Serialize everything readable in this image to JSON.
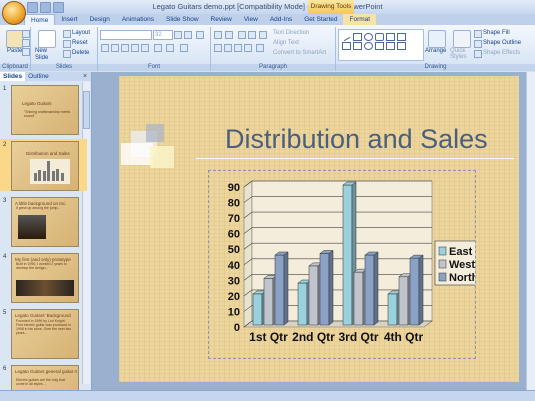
{
  "window": {
    "title": "Legato Guitars demo.ppt [Compatibility Mode] - Microsoft PowerPoint",
    "contextual_tab_group": "Drawing Tools"
  },
  "ribbon_tabs": [
    "Home",
    "Insert",
    "Design",
    "Animations",
    "Slide Show",
    "Review",
    "View",
    "Add-Ins",
    "Get Started",
    "Format"
  ],
  "ribbon": {
    "clipboard": {
      "label": "Clipboard",
      "paste": "Paste"
    },
    "slides": {
      "label": "Slides",
      "new_slide": "New Slide",
      "layout": "Layout",
      "reset": "Reset",
      "delete": "Delete"
    },
    "font": {
      "label": "Font",
      "size": "32"
    },
    "paragraph": {
      "label": "Paragraph",
      "text_direction": "Text Direction",
      "align_text": "Align Text",
      "convert_smartart": "Convert to SmartArt"
    },
    "drawing": {
      "label": "Drawing",
      "arrange": "Arrange",
      "quick_styles": "Quick Styles",
      "shape_fill": "Shape Fill",
      "shape_outline": "Shape Outline",
      "shape_effects": "Shape Effects"
    }
  },
  "pane": {
    "tabs": [
      "Slides",
      "Outline"
    ],
    "close": "×",
    "thumbnails": [
      {
        "num": "1",
        "title": "Legato Guitars",
        "sub": "\"Shining craftsmanship meets sound\""
      },
      {
        "num": "2",
        "title": "Distribution and Sales",
        "sub": ""
      },
      {
        "num": "3",
        "title": "A little background on Inc.",
        "sub": "It grew up among the jump..."
      },
      {
        "num": "4",
        "title": "My first (and only) prototype",
        "sub": "Built in 1990, I worked 2 years to develop the design..."
      },
      {
        "num": "5",
        "title": "Legato Guitars' Background",
        "sub": "Founded in 1996 by Lori Knight. First electric guitar was produced in 1998 in his store. Over the next two years..."
      },
      {
        "num": "6",
        "title": "Legato Guitars general guitar market info",
        "sub": "Electric guitars are the only that come in all styles..."
      }
    ]
  },
  "slide": {
    "title": "Distribution and Sales"
  },
  "chart_data": {
    "type": "bar",
    "categories": [
      "1st Qtr",
      "2nd Qtr",
      "3rd Qtr",
      "4th Qtr"
    ],
    "series": [
      {
        "name": "East",
        "color": "#9bd0dd",
        "values": [
          20,
          27,
          90,
          20
        ]
      },
      {
        "name": "West",
        "color": "#c0c4cc",
        "values": [
          30,
          38,
          34,
          31
        ]
      },
      {
        "name": "North",
        "color": "#8aa2c6",
        "values": [
          45,
          46,
          45,
          43
        ]
      }
    ],
    "yticks": [
      "0",
      "10",
      "20",
      "30",
      "40",
      "50",
      "60",
      "70",
      "80",
      "90"
    ],
    "ylim": [
      0,
      90
    ],
    "legend": "right",
    "grid": true
  }
}
